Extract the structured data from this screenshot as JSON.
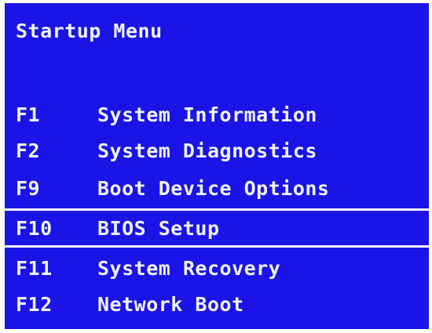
{
  "colors": {
    "background": "#1a14e6",
    "text": "#f2f2ff",
    "selection_border": "#ffffff",
    "frame": "#ffffff"
  },
  "menu": {
    "title": "Startup Menu",
    "selected_key": "F10",
    "items": [
      {
        "key": "F1",
        "label": "System Information"
      },
      {
        "key": "F2",
        "label": "System Diagnostics"
      },
      {
        "key": "F9",
        "label": "Boot Device Options"
      },
      {
        "key": "F10",
        "label": "BIOS Setup"
      },
      {
        "key": "F11",
        "label": "System Recovery"
      },
      {
        "key": "F12",
        "label": "Network Boot"
      }
    ]
  }
}
